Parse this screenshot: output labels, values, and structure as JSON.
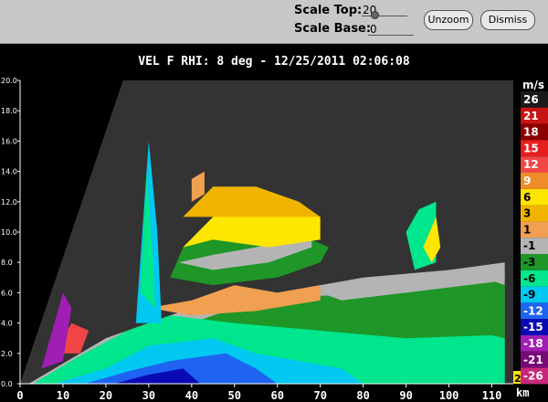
{
  "toolbar": {
    "scale_top_label": "Scale Top:",
    "scale_top_value": "20",
    "scale_base_label": "Scale Base:",
    "scale_base_value": "0",
    "unzoom_label": "Unzoom",
    "dismiss_label": "Dismiss"
  },
  "plot_title": "VEL F  RHI: 8 deg  -  12/25/2011 02:06:08",
  "x_unit": "km",
  "legend_unit": "m/s",
  "corner_badge": "2",
  "colors": {
    "background": "#3a3a3a",
    "no_data": "#000000",
    "plot_bg": "#333333"
  },
  "chart_data": {
    "type": "heatmap",
    "title": "VEL F  RHI: 8 deg  -  12/25/2011 02:06:08",
    "xlabel": "km",
    "ylabel": "",
    "xlim": [
      0,
      115
    ],
    "ylim": [
      0,
      20
    ],
    "x_ticks": [
      0,
      10,
      20,
      30,
      40,
      50,
      60,
      70,
      80,
      90,
      100,
      110
    ],
    "y_ticks": [
      "0.0",
      "2.0",
      "4.0",
      "6.0",
      "8.0",
      "10.0",
      "12.0",
      "14.0",
      "16.0",
      "18.0",
      "20.0"
    ],
    "colorbar": [
      {
        "label": "26",
        "color": "#1a1a1a",
        "text": "#ffffff"
      },
      {
        "label": "21",
        "color": "#c81414",
        "text": "#ffffff"
      },
      {
        "label": "18",
        "color": "#8c0000",
        "text": "#ffffff"
      },
      {
        "label": "15",
        "color": "#e61e1e",
        "text": "#ffffff"
      },
      {
        "label": "12",
        "color": "#f04646",
        "text": "#ffffff"
      },
      {
        "label": "9",
        "color": "#f08c28",
        "text": "#ffffff"
      },
      {
        "label": "6",
        "color": "#ffe600",
        "text": "#000000"
      },
      {
        "label": "3",
        "color": "#f0b400",
        "text": "#000000"
      },
      {
        "label": "1",
        "color": "#f0a050",
        "text": "#000000"
      },
      {
        "label": "-1",
        "color": "#b4b4b4",
        "text": "#000000"
      },
      {
        "label": "-3",
        "color": "#1e9628",
        "text": "#000000"
      },
      {
        "label": "-6",
        "color": "#00e68c",
        "text": "#000000"
      },
      {
        "label": "-9",
        "color": "#00c8f0",
        "text": "#000000"
      },
      {
        "label": "-12",
        "color": "#1e64f0",
        "text": "#ffffff"
      },
      {
        "label": "-15",
        "color": "#0a0ab4",
        "text": "#ffffff"
      },
      {
        "label": "-18",
        "color": "#a01eb4",
        "text": "#ffffff"
      },
      {
        "label": "-21",
        "color": "#780a78",
        "text": "#ffffff"
      },
      {
        "label": "-26",
        "color": "#c8287a",
        "text": "#ffffff"
      }
    ]
  }
}
